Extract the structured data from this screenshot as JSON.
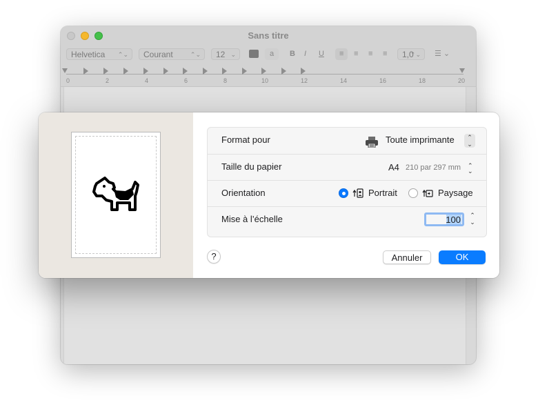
{
  "window": {
    "title": "Sans titre",
    "format_bar": {
      "font_family": "Helvetica",
      "font_style": "Courant",
      "font_size": "12",
      "bold": "B",
      "italic": "I",
      "underline": "U",
      "line_spacing": "1,0"
    },
    "ruler": {
      "ticks": [
        "0",
        "2",
        "4",
        "6",
        "8",
        "10",
        "12",
        "14",
        "16",
        "18",
        "20"
      ]
    }
  },
  "page_setup": {
    "format_for": {
      "label": "Format pour",
      "value": "Toute imprimante"
    },
    "paper_size": {
      "label": "Taille du papier",
      "name": "A4",
      "dimensions": "210 par 297 mm"
    },
    "orientation": {
      "label": "Orientation",
      "portrait": "Portrait",
      "landscape": "Paysage",
      "selected": "Portrait"
    },
    "scale": {
      "label": "Mise à l’échelle",
      "value": "100"
    },
    "help_label": "?",
    "cancel_label": "Annuler",
    "ok_label": "OK"
  },
  "colors": {
    "accent": "#0a7cff",
    "sidebar": "#ebe7e1"
  }
}
